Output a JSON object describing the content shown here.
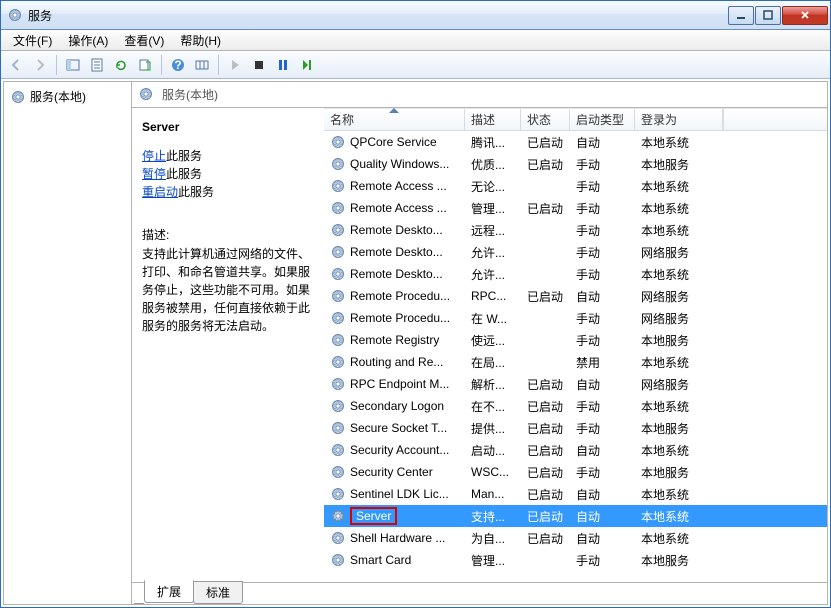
{
  "window": {
    "title": "服务"
  },
  "menu": {
    "file": "文件(F)",
    "action": "操作(A)",
    "view": "查看(V)",
    "help": "帮助(H)"
  },
  "tree": {
    "root": "服务(本地)"
  },
  "panel_header": "服务(本地)",
  "info": {
    "selected_name": "Server",
    "stop_link": "停止",
    "stop_suffix": "此服务",
    "pause_link": "暂停",
    "pause_suffix": "此服务",
    "restart_link": "重启动",
    "restart_suffix": "此服务",
    "desc_label": "描述:",
    "desc": "支持此计算机通过网络的文件、打印、和命名管道共享。如果服务停止，这些功能不可用。如果服务被禁用，任何直接依赖于此服务的服务将无法启动。"
  },
  "columns": {
    "name": "名称",
    "desc": "描述",
    "status": "状态",
    "startup": "启动类型",
    "logon": "登录为"
  },
  "services": [
    {
      "name": "QPCore Service",
      "desc": "腾讯...",
      "status": "已启动",
      "startup": "自动",
      "logon": "本地系统"
    },
    {
      "name": "Quality Windows...",
      "desc": "优质...",
      "status": "已启动",
      "startup": "手动",
      "logon": "本地服务"
    },
    {
      "name": "Remote Access ...",
      "desc": "无论...",
      "status": "",
      "startup": "手动",
      "logon": "本地系统"
    },
    {
      "name": "Remote Access ...",
      "desc": "管理...",
      "status": "已启动",
      "startup": "手动",
      "logon": "本地系统"
    },
    {
      "name": "Remote Deskto...",
      "desc": "远程...",
      "status": "",
      "startup": "手动",
      "logon": "本地系统"
    },
    {
      "name": "Remote Deskto...",
      "desc": "允许...",
      "status": "",
      "startup": "手动",
      "logon": "网络服务"
    },
    {
      "name": "Remote Deskto...",
      "desc": "允许...",
      "status": "",
      "startup": "手动",
      "logon": "本地系统"
    },
    {
      "name": "Remote Procedu...",
      "desc": "RPC...",
      "status": "已启动",
      "startup": "自动",
      "logon": "网络服务"
    },
    {
      "name": "Remote Procedu...",
      "desc": "在 W...",
      "status": "",
      "startup": "手动",
      "logon": "网络服务"
    },
    {
      "name": "Remote Registry",
      "desc": "使远...",
      "status": "",
      "startup": "手动",
      "logon": "本地服务"
    },
    {
      "name": "Routing and Re...",
      "desc": "在局...",
      "status": "",
      "startup": "禁用",
      "logon": "本地系统"
    },
    {
      "name": "RPC Endpoint M...",
      "desc": "解析...",
      "status": "已启动",
      "startup": "自动",
      "logon": "网络服务"
    },
    {
      "name": "Secondary Logon",
      "desc": "在不...",
      "status": "已启动",
      "startup": "手动",
      "logon": "本地系统"
    },
    {
      "name": "Secure Socket T...",
      "desc": "提供...",
      "status": "已启动",
      "startup": "手动",
      "logon": "本地服务"
    },
    {
      "name": "Security Account...",
      "desc": "启动...",
      "status": "已启动",
      "startup": "自动",
      "logon": "本地系统"
    },
    {
      "name": "Security Center",
      "desc": "WSC...",
      "status": "已启动",
      "startup": "手动",
      "logon": "本地服务"
    },
    {
      "name": "Sentinel LDK Lic...",
      "desc": "Man...",
      "status": "已启动",
      "startup": "自动",
      "logon": "本地系统"
    },
    {
      "name": "Server",
      "desc": "支持...",
      "status": "已启动",
      "startup": "自动",
      "logon": "本地系统",
      "selected": true
    },
    {
      "name": "Shell Hardware ...",
      "desc": "为自...",
      "status": "已启动",
      "startup": "自动",
      "logon": "本地系统"
    },
    {
      "name": "Smart Card",
      "desc": "管理...",
      "status": "",
      "startup": "手动",
      "logon": "本地服务"
    }
  ],
  "tabs": {
    "extended": "扩展",
    "standard": "标准"
  }
}
